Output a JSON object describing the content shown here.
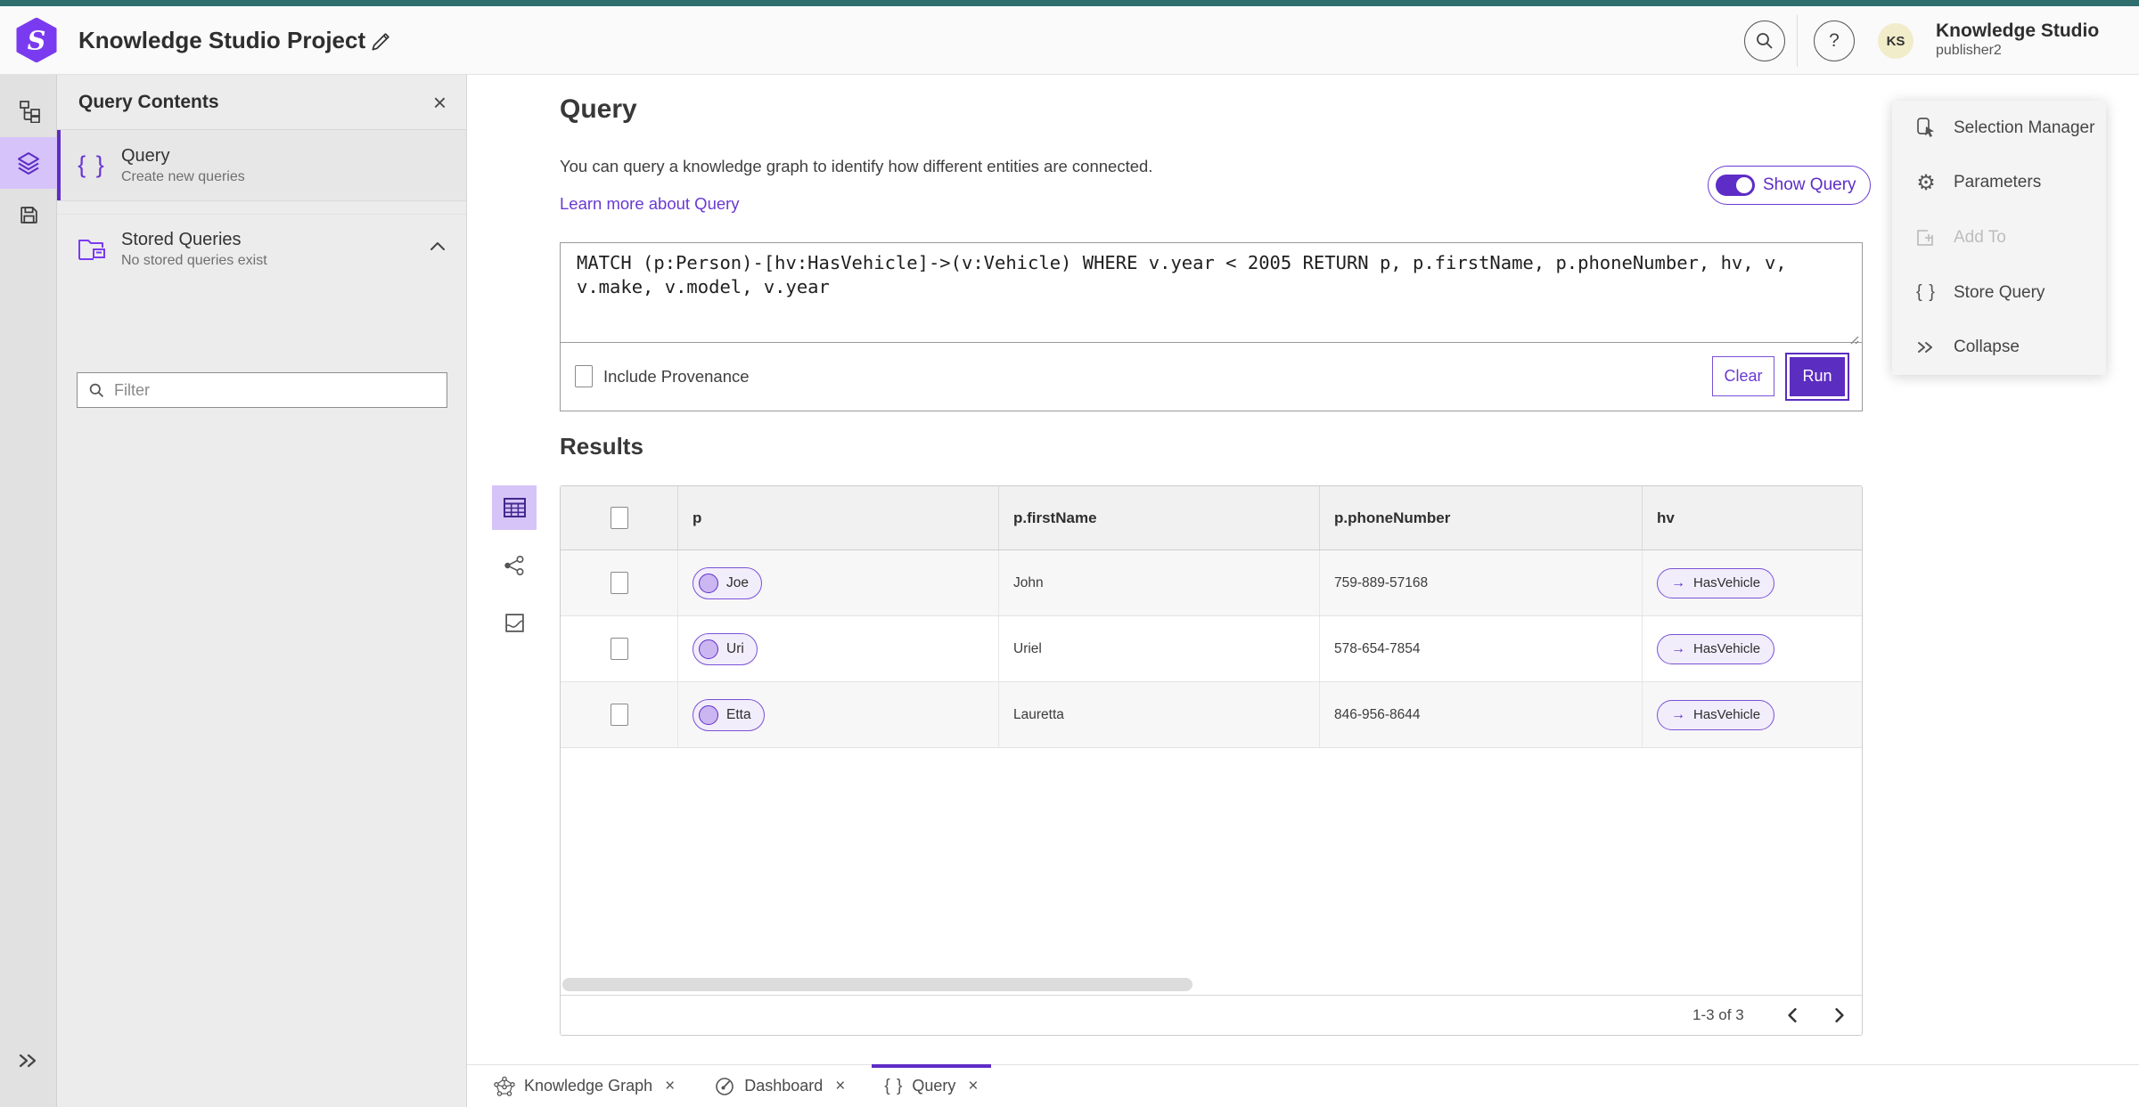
{
  "header": {
    "title": "Knowledge Studio Project",
    "account_name": "Knowledge Studio",
    "account_role": "publisher2",
    "avatar_initials": "KS"
  },
  "icons": {
    "close": "×",
    "help": "?",
    "braces": "{ }",
    "arrow_right": "→",
    "collapse_chevrons": "»",
    "gear": "⚙"
  },
  "contents_panel": {
    "title": "Query Contents",
    "query_item": {
      "label": "Query",
      "description": "Create new queries"
    },
    "stored_item": {
      "label": "Stored Queries",
      "description": "No stored queries exist"
    },
    "filter_placeholder": "Filter"
  },
  "query_section": {
    "heading": "Query",
    "description": "You can query a knowledge graph to identify how different entities are connected.",
    "learn_more": "Learn more about Query",
    "show_query_label": "Show Query",
    "query_text": "MATCH (p:Person)-[hv:HasVehicle]->(v:Vehicle) WHERE v.year < 2005 RETURN p, p.firstName, p.phoneNumber, hv, v, v.make, v.model, v.year",
    "include_provenance_label": "Include Provenance",
    "clear_label": "Clear",
    "run_label": "Run"
  },
  "results": {
    "heading": "Results",
    "columns": {
      "c0": "p",
      "c1": "p.firstName",
      "c2": "p.phoneNumber",
      "c3": "hv"
    },
    "rows": [
      {
        "p": "Joe",
        "firstName": "John",
        "phoneNumber": "759-889-57168",
        "hv": "HasVehicle"
      },
      {
        "p": "Uri",
        "firstName": "Uriel",
        "phoneNumber": "578-654-7854",
        "hv": "HasVehicle"
      },
      {
        "p": "Etta",
        "firstName": "Lauretta",
        "phoneNumber": "846-956-8644",
        "hv": "HasVehicle"
      }
    ],
    "page_range": "1-3 of 3"
  },
  "tools_panel": {
    "items": [
      {
        "label": "Selection Manager",
        "disabled": false
      },
      {
        "label": "Parameters",
        "disabled": false
      },
      {
        "label": "Add To",
        "disabled": true
      },
      {
        "label": "Store Query",
        "disabled": false
      },
      {
        "label": "Collapse",
        "disabled": false
      }
    ]
  },
  "tabs": [
    {
      "label": "Knowledge Graph"
    },
    {
      "label": "Dashboard"
    },
    {
      "label": "Query",
      "active": true
    }
  ],
  "colors": {
    "primary": "#5e2cc7",
    "primary_light": "#d6c4f8",
    "pill_fill": "#f2edfb",
    "teal_strip": "#2e6f6e",
    "avatar_bg": "#f1ecca",
    "link": "#6a3ad2"
  }
}
